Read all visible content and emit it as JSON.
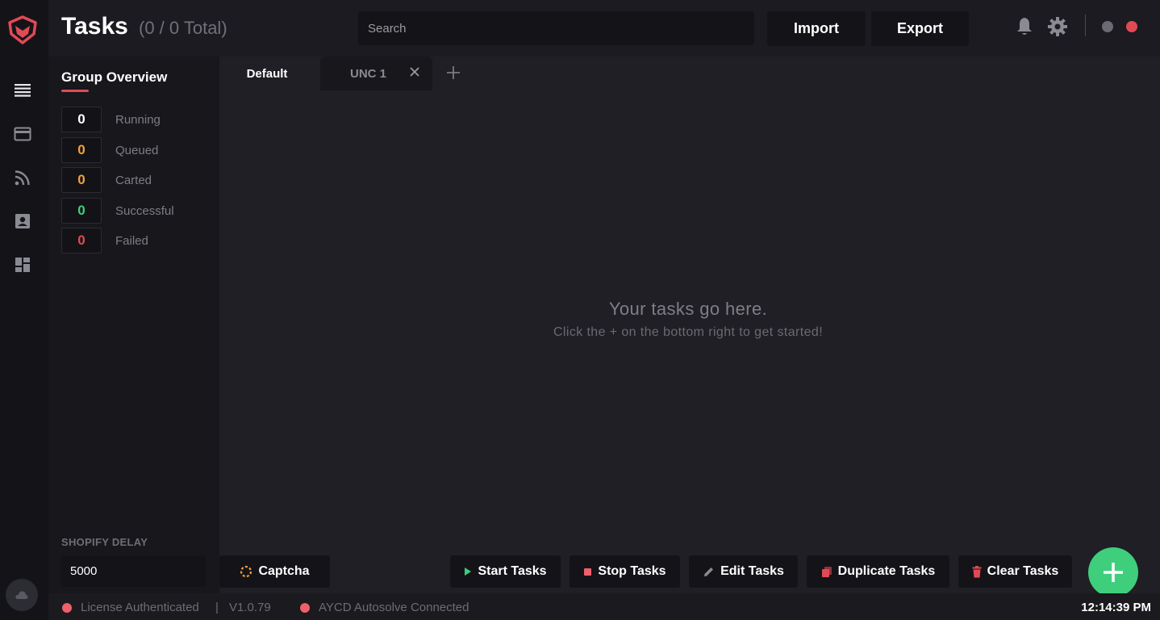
{
  "header": {
    "title": "Tasks",
    "count": "(0 / 0 Total)",
    "search_placeholder": "Search",
    "import_label": "Import",
    "export_label": "Export"
  },
  "group_overview": {
    "title": "Group Overview",
    "stats": [
      {
        "value": "0",
        "label": "Running",
        "color": "#ffffff"
      },
      {
        "value": "0",
        "label": "Queued",
        "color": "#f2a23c"
      },
      {
        "value": "0",
        "label": "Carted",
        "color": "#f2a23c"
      },
      {
        "value": "0",
        "label": "Successful",
        "color": "#3fce7c"
      },
      {
        "value": "0",
        "label": "Failed",
        "color": "#e04a55"
      }
    ]
  },
  "tabs": [
    {
      "label": "Default"
    },
    {
      "label": "UNC 1"
    }
  ],
  "empty_state": {
    "title": "Your tasks go here.",
    "subtitle": "Click the + on the bottom right to get started!"
  },
  "shopify_delay": {
    "label": "SHOPIFY DELAY",
    "value": "5000"
  },
  "actions": {
    "captcha": "Captcha",
    "start": "Start Tasks",
    "stop": "Stop Tasks",
    "edit": "Edit Tasks",
    "duplicate": "Duplicate Tasks",
    "clear": "Clear Tasks"
  },
  "status_bar": {
    "license": "License Authenticated",
    "separator": "|",
    "version": "V1.0.79",
    "aycd": "AYCD Autosolve Connected",
    "time": "12:14:39 PM"
  },
  "colors": {
    "accent_red": "#e04a55",
    "accent_green": "#3fce7c",
    "accent_orange": "#f2a23c",
    "status_dot": "#f0606a"
  }
}
